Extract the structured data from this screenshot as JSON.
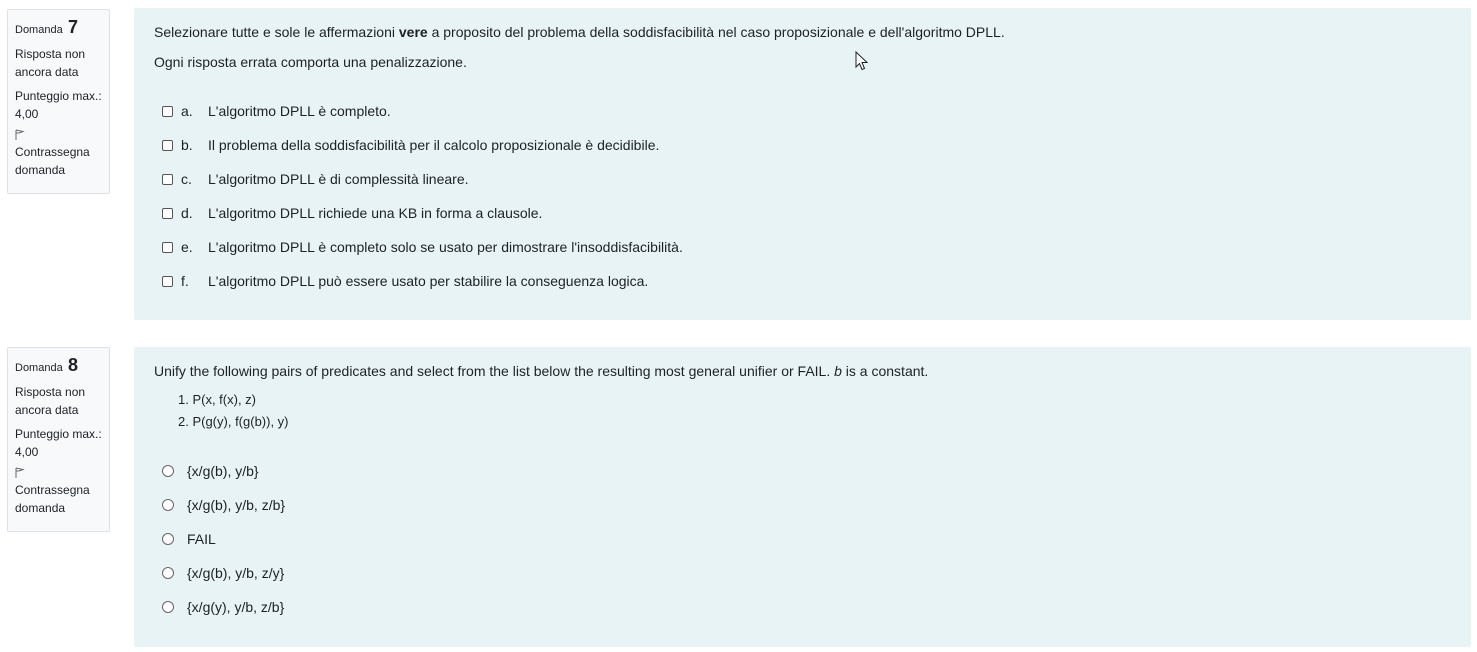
{
  "q7": {
    "qno_label": "Domanda",
    "qno_num": "7",
    "state": "Risposta non ancora data",
    "grade_label": "Punteggio max.:",
    "grade_value": "4,00",
    "flag_label": "Contrassegna domanda",
    "text_before": "Selezionare tutte e sole le affermazioni ",
    "text_bold": "vere",
    "text_after": " a proposito del problema della soddisfacibilità nel caso proposizionale e dell'algoritmo DPLL.",
    "text2": "Ogni risposta errata comporta una penalizzazione.",
    "options": [
      {
        "letter": "a.",
        "text": "L'algoritmo DPLL è completo."
      },
      {
        "letter": "b.",
        "text": "Il problema della soddisfacibilità per il calcolo proposizionale è decidibile."
      },
      {
        "letter": "c.",
        "text": "L'algoritmo DPLL è di complessità lineare."
      },
      {
        "letter": "d.",
        "text": "L'algoritmo DPLL richiede una KB in forma a clausole."
      },
      {
        "letter": "e.",
        "text": "L'algoritmo DPLL è completo solo se usato per dimostrare l'insoddisfacibilità."
      },
      {
        "letter": "f.",
        "text": "L'algoritmo DPLL può essere usato per stabilire la conseguenza logica."
      }
    ]
  },
  "q8": {
    "qno_label": "Domanda",
    "qno_num": "8",
    "state": "Risposta non ancora data",
    "grade_label": "Punteggio max.:",
    "grade_value": "4,00",
    "flag_label": "Contrassegna domanda",
    "text_before": "Unify the following pairs of predicates and select from the list below the resulting most general unifier or FAIL. ",
    "text_italic": "b",
    "text_after": " is a constant.",
    "pairs": [
      "1. P(x, f(x), z)",
      "2. P(g(y), f(g(b)), y)"
    ],
    "options": [
      "{x/g(b), y/b}",
      "{x/g(b), y/b, z/b}",
      "FAIL",
      "{x/g(b), y/b, z/y}",
      "{x/g(y), y/b, z/b}"
    ]
  }
}
